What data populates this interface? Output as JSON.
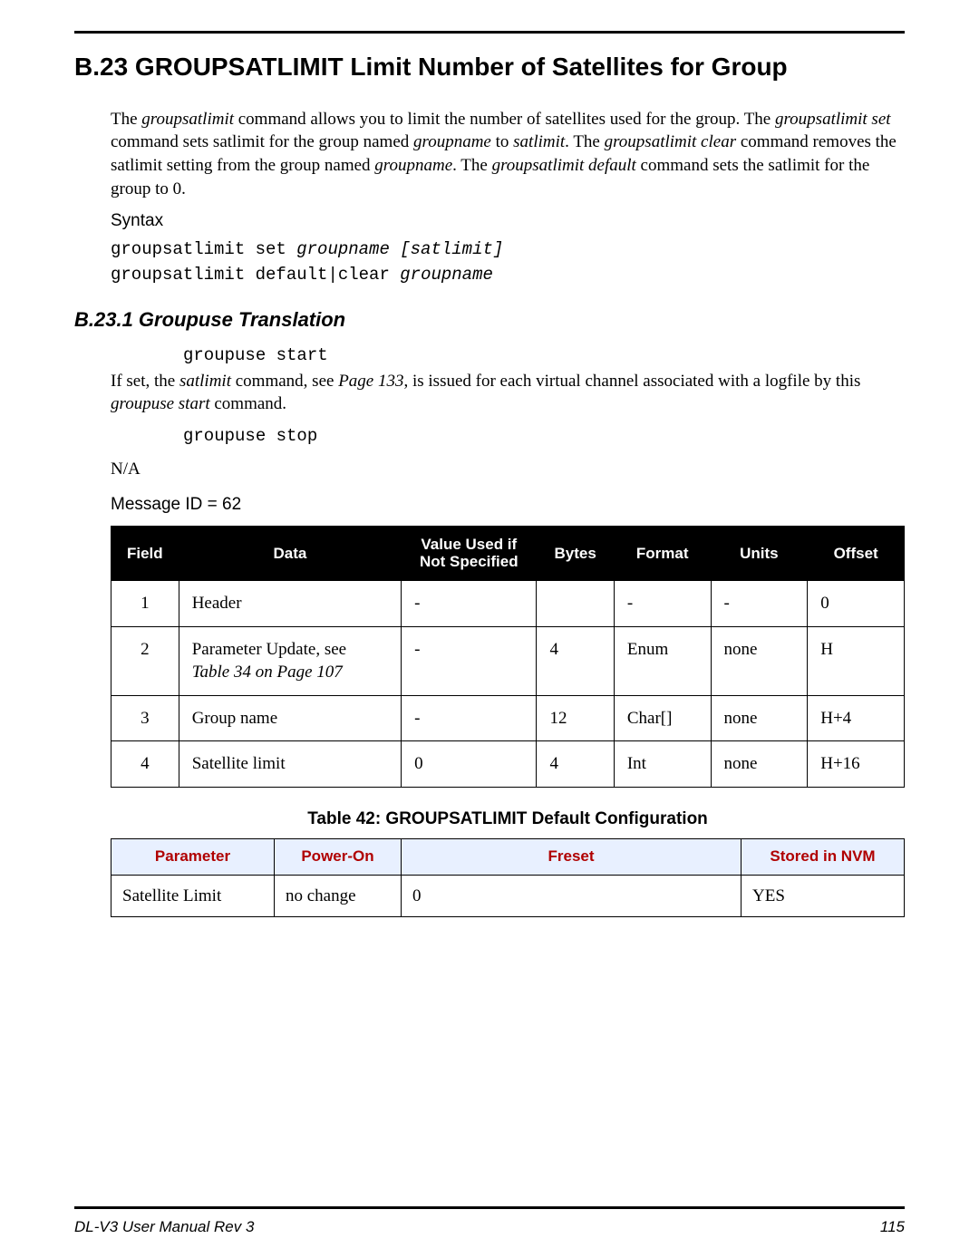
{
  "heading": "B.23 GROUPSATLIMIT   Limit Number of Satellites for Group",
  "intro": "The groupsatlimit command allows you to limit the number of satellites used for the group. The groupsatlimit set command sets satlimit for the group named groupname to satlimit. The groupsatlimit clear command removes the satlimit setting from the group named groupname. The groupsatlimit default command sets the satlimit for the group to 0.",
  "syntaxLabel": "Syntax",
  "syntax1_a": "groupsatlimit set ",
  "syntax1_b": "groupname [satlimit]",
  "syntax2_a": "groupsatlimit default|clear ",
  "syntax2_b": "groupname",
  "subheading": "B.23.1  Groupuse Translation",
  "codeA": "groupuse start",
  "paraA_1": "If set, the ",
  "paraA_2": "satlimit",
  "paraA_3": " command, see ",
  "paraA_4": "Page 133",
  "paraA_5": ", is issued for each virtual channel associated with a logfile by this ",
  "paraA_6": "groupuse start",
  "paraA_7": " command.",
  "codeB": "groupuse stop",
  "na": "N/A",
  "msgid": "Message ID = 62",
  "table1": {
    "headers": [
      "Field",
      "Data",
      "Value Used if\nNot Specified",
      "Bytes",
      "Format",
      "Units",
      "Offset"
    ],
    "rows": [
      {
        "field": "1",
        "data": "Header",
        "dataRef": "",
        "value": "-",
        "bytes": "",
        "format": "-",
        "units": "-",
        "offset": "0"
      },
      {
        "field": "2",
        "data": "Parameter Update, see ",
        "dataRef": "Table 34 on Page 107",
        "value": "-",
        "bytes": "4",
        "format": "Enum",
        "units": "none",
        "offset": "H"
      },
      {
        "field": "3",
        "data": "Group name",
        "dataRef": "",
        "value": "-",
        "bytes": "12",
        "format": "Char[]",
        "units": "none",
        "offset": "H+4"
      },
      {
        "field": "4",
        "data": "Satellite limit",
        "dataRef": "",
        "value": "0",
        "bytes": "4",
        "format": "Int",
        "units": "none",
        "offset": "H+16"
      }
    ]
  },
  "table2Caption": "Table 42:  GROUPSATLIMIT Default Configuration",
  "table2": {
    "headers": [
      "Parameter",
      "Power-On",
      "Freset",
      "Stored in NVM"
    ],
    "rows": [
      {
        "param": "Satellite Limit",
        "poweron": "no change",
        "freset": "0",
        "nvm": "YES"
      }
    ]
  },
  "footerLeft": "DL-V3 User Manual Rev 3",
  "footerRight": "115"
}
